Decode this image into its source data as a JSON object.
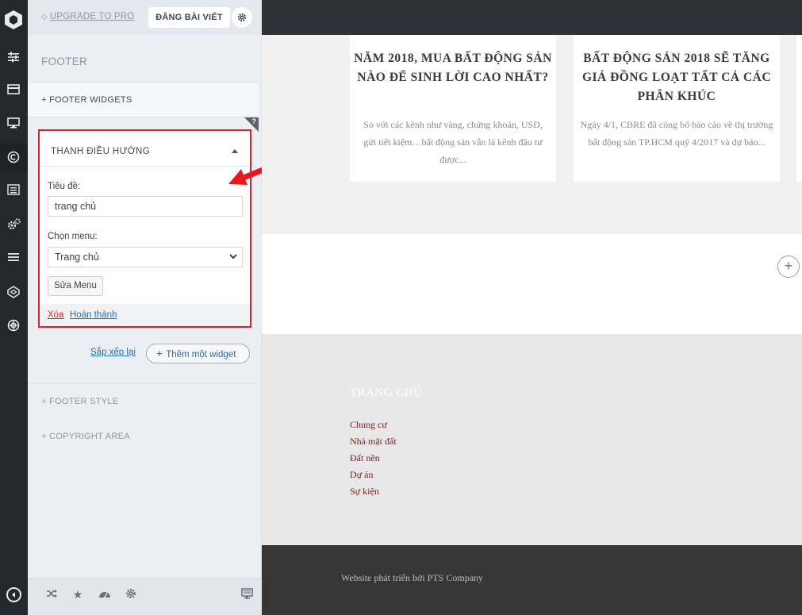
{
  "header": {
    "upgrade_label": "UPGRADE TO PRO",
    "publish_label": "ĐĂNG BÀI VIẾT"
  },
  "panel": {
    "section_title": "FOOTER",
    "footer_widgets_label": "+  FOOTER WIDGETS",
    "corner_tag": "?",
    "widget": {
      "title": "THANH ĐIỀU HƯỚNG",
      "title_field_label": "Tiêu đề:",
      "title_field_value": "trang chủ",
      "menu_field_label": "Chọn menu:",
      "menu_selected": "Trang chủ",
      "edit_menu_label": "Sửa Menu",
      "delete_label": "Xóa",
      "done_label": "Hoàn thành"
    },
    "reorder_label": "Sắp xếp lại",
    "add_widget_label": "Thêm một widget",
    "footer_style_label": "+  FOOTER STYLE",
    "copyright_label": "+  COPYRIGHT AREA"
  },
  "preview": {
    "cards": [
      {
        "title": "NĂM 2018, MUA BẤT ĐỘNG SẢN NÀO ĐỂ SINH LỜI CAO NHẤT?",
        "excerpt": "So với các kênh như vàng, chứng khoán, USD, gửi tiết kiệm…bất động sản vẫn là kênh đầu tư được..."
      },
      {
        "title": "BẤT ĐỘNG SẢN 2018 SẼ TĂNG GIÁ ĐỒNG LOẠT TẤT CẢ CÁC PHÂN KHÚC",
        "excerpt": "Ngày 4/1, CBRE đã công bố báo cáo về thị trường bất động sản TP.HCM quý 4/2017 và dự báo..."
      }
    ],
    "footer_menu_title": "TRANG CHỦ",
    "footer_links": [
      "Chung cư",
      "Nhà mặt đất",
      "Đất nền",
      "Dự án",
      "Sự kiện"
    ],
    "credit": "Website phát triển bởi PTS Company"
  },
  "colors": {
    "highlight_border": "#d8222b",
    "rail_bg": "#23282d",
    "link_blue": "#2073b5"
  }
}
